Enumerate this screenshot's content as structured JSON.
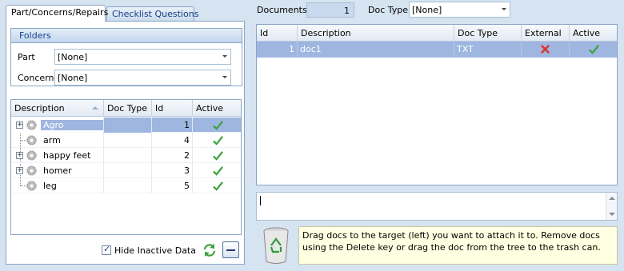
{
  "tabs": [
    {
      "label": "Part/Concerns/Repairs",
      "active": true
    },
    {
      "label": "Checklist Questions",
      "active": false
    }
  ],
  "folders": {
    "title": "Folders",
    "part_label": "Part",
    "part_value": "[None]",
    "concern_label": "Concern",
    "concern_value": "[None]"
  },
  "tree": {
    "columns": [
      "Description",
      "Doc Type",
      "Id",
      "Active"
    ],
    "rows": [
      {
        "description": "Agro",
        "doc_type": "",
        "id": "1",
        "active": true,
        "expandable": true,
        "selected": true
      },
      {
        "description": "arm",
        "doc_type": "",
        "id": "4",
        "active": true,
        "expandable": false,
        "selected": false
      },
      {
        "description": "happy feet",
        "doc_type": "",
        "id": "2",
        "active": true,
        "expandable": true,
        "selected": false
      },
      {
        "description": "homer",
        "doc_type": "",
        "id": "3",
        "active": true,
        "expandable": true,
        "selected": false
      },
      {
        "description": "leg",
        "doc_type": "",
        "id": "5",
        "active": true,
        "expandable": false,
        "selected": false
      }
    ]
  },
  "hide_inactive": {
    "label": "Hide Inactive Data",
    "checked": true
  },
  "documents": {
    "label": "Documents",
    "count": "1",
    "doc_type_label": "Doc Type",
    "doc_type_value": "[None]"
  },
  "docs_grid": {
    "columns": [
      "Id",
      "Description",
      "Doc Type",
      "External",
      "Active"
    ],
    "rows": [
      {
        "id": "1",
        "description": "doc1",
        "doc_type": "TXT",
        "external": false,
        "active": true
      }
    ]
  },
  "hint_text": "Drag docs to the target (left) you want to attach it to. Remove docs using the Delete key or drag the doc from the tree to the trash can.",
  "colors": {
    "selection": "#9eb6e0",
    "border": "#8aa5c6",
    "background": "#d6e3f1",
    "check": "#3aa23a",
    "cross": "#e0342b"
  }
}
